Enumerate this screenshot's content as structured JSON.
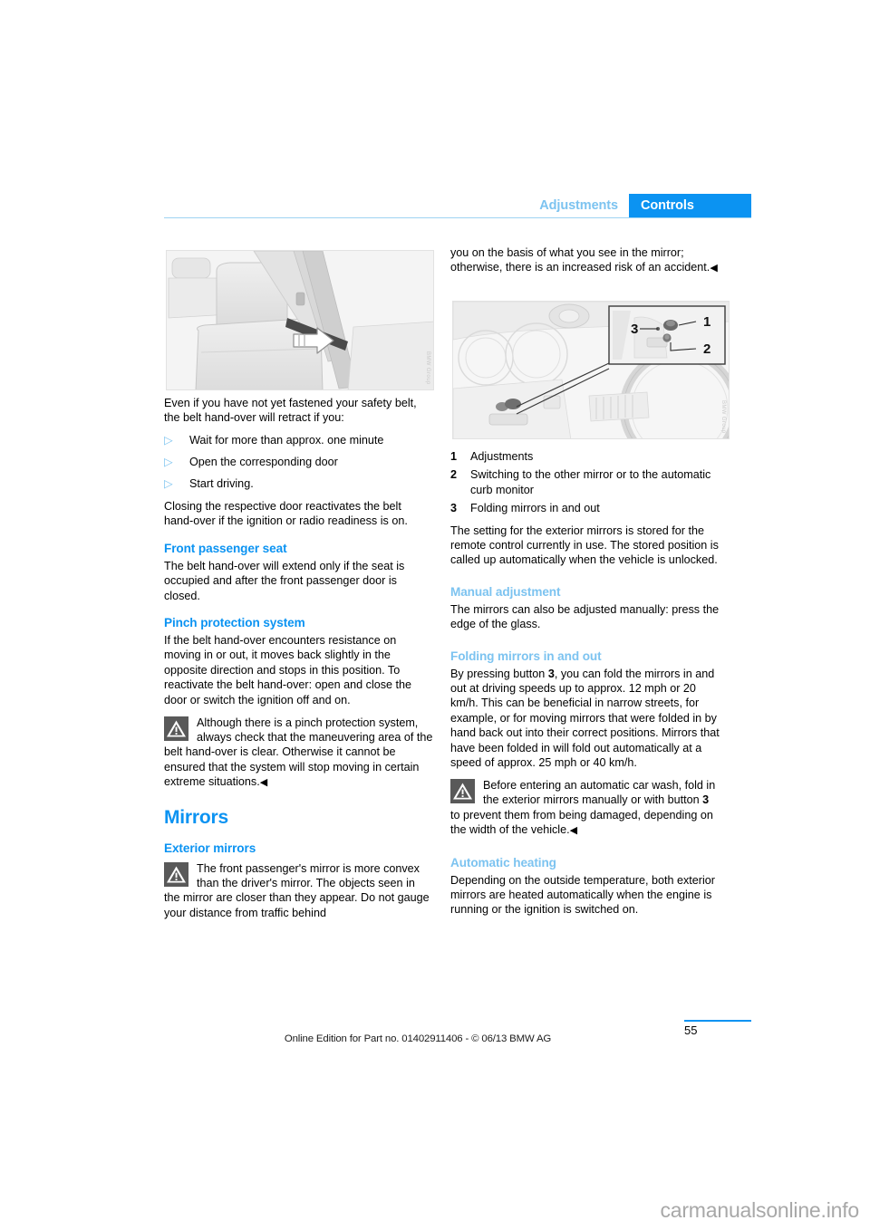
{
  "header": {
    "chapter": "Adjustments",
    "section": "Controls"
  },
  "left_column": {
    "figure_seat": {
      "alt": "seat-belt-hand-over-illustration",
      "watermark": "BMW Group"
    },
    "intro": "Even if you have not yet fastened your safety belt, the belt hand-over will retract if you:",
    "bullets": [
      {
        "marker": "▷",
        "text": "Wait for more than approx. one minute"
      },
      {
        "marker": "▷",
        "text": "Open the corresponding door"
      },
      {
        "marker": "▷",
        "text": "Start driving."
      }
    ],
    "after_bullets": "Closing the respective door reactivates the belt hand-over if the ignition or radio readiness is on.",
    "front_passenger_seat": {
      "heading": "Front passenger seat",
      "text": "The belt hand-over will extend only if the seat is occupied and after the front passenger door is closed."
    },
    "pinch_protection": {
      "heading": "Pinch protection system",
      "text": "If the belt hand-over encounters resistance on moving in or out, it moves back slightly in the opposite direction and stops in this position. To reactivate the belt hand-over: open and close the door or switch the ignition off and on.",
      "warning": "Although there is a pinch protection system, always check that the maneuvering area of the belt hand-over is clear. Otherwise it cannot be ensured that the system will stop moving in certain extreme situations.",
      "warning_end_mark": "◀"
    },
    "mirrors": {
      "heading": "Mirrors",
      "exterior_heading": "Exterior mirrors",
      "warning": "The front passenger's mirror is more convex than the driver's mirror. The objects seen in the mirror are closer than they appear. Do not gauge your distance from traffic behind"
    }
  },
  "right_column": {
    "continued_warning": "you on the basis of what you see in the mirror; otherwise, there is an increased risk of an accident.",
    "continued_warning_end_mark": "◀",
    "figure_cockpit": {
      "alt": "cockpit-mirror-controls-illustration",
      "callout_labels": [
        "1",
        "2",
        "3"
      ],
      "watermark": "BMW Group"
    },
    "legend": [
      {
        "number": "1",
        "text": "Adjustments"
      },
      {
        "number": "2",
        "text": "Switching to the other mirror or to the automatic curb monitor"
      },
      {
        "number": "3",
        "text": "Folding mirrors in and out"
      }
    ],
    "legend_note": "The setting for the exterior mirrors is stored for the remote control currently in use. The stored position is called up automatically when the vehicle is unlocked.",
    "manual_adjustment": {
      "heading": "Manual adjustment",
      "text": "The mirrors can also be adjusted manually: press the edge of the glass."
    },
    "folding_mirrors": {
      "heading": "Folding mirrors in and out",
      "text_part1": "By pressing button ",
      "button_ref": "3",
      "text_part2": ", you can fold the mirrors in and out at driving speeds up to approx. 12 mph or 20 km/h. This can be beneficial in narrow streets, for example, or for moving mirrors that were folded in by hand back out into their correct positions. Mirrors that have been folded in will fold out automatically at a speed of approx. 25 mph or 40 km/h.",
      "warning_part1": "Before entering an automatic car wash, fold in the exterior mirrors manually or with button ",
      "warning_button_ref": "3",
      "warning_part2": " to prevent them from being damaged, depending on the width of the vehicle.",
      "warning_end_mark": "◀"
    },
    "automatic_heating": {
      "heading": "Automatic heating",
      "text": "Depending on the outside temperature, both exterior mirrors are heated automatically when the engine is running or the ignition is switched on."
    }
  },
  "footer": {
    "page_number": "55",
    "note": "Online Edition for Part no. 01402911406 - © 06/13 BMW AG"
  },
  "watermark": "carmanualsonline.info",
  "colors": {
    "accent_blue": "#0b93f2",
    "light_blue": "#7cc3f0",
    "rule_blue": "#9ed3f2"
  }
}
